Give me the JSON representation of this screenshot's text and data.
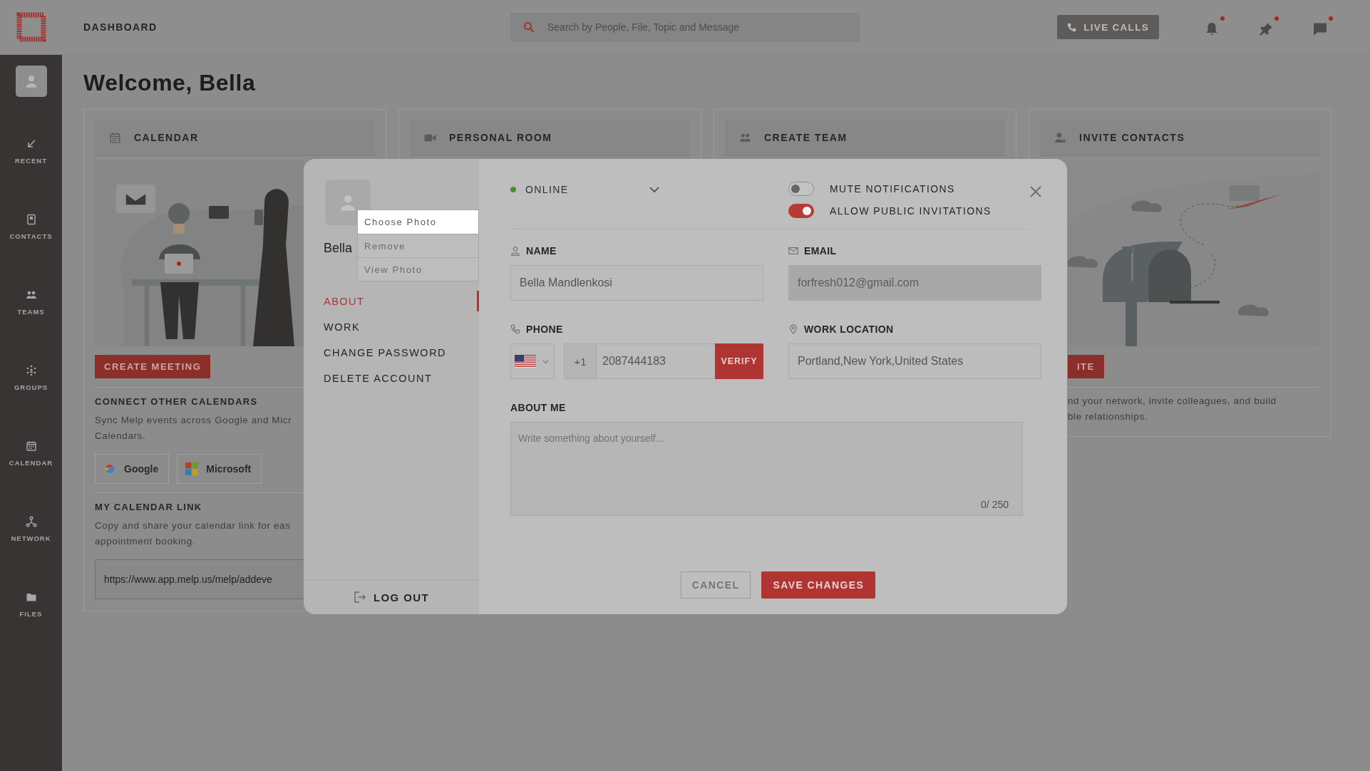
{
  "top_bar": {
    "title": "DASHBOARD",
    "search": {
      "placeholder": "Search by People, File, Topic and Message"
    },
    "live_calls": "LIVE CALLS",
    "icons": [
      {
        "kind": "bell",
        "badge": true
      },
      {
        "kind": "pin",
        "badge": true
      },
      {
        "kind": "chat",
        "badge": true
      }
    ]
  },
  "sidebar": {
    "items": [
      {
        "kind": "recent",
        "label": "RECENT"
      },
      {
        "kind": "contacts",
        "label": "CONTACTS"
      },
      {
        "kind": "teams",
        "label": "TEAMS"
      },
      {
        "kind": "groups",
        "label": "GROUPS"
      },
      {
        "kind": "calendar",
        "label": "CALENDAR"
      },
      {
        "kind": "network",
        "label": "NETWORK"
      },
      {
        "kind": "files",
        "label": "FILES"
      }
    ]
  },
  "welcome": "Welcome, Bella",
  "calendar_card": {
    "title": "CALENDAR",
    "button": "CREATE MEETING",
    "connect_title": "CONNECT OTHER CALENDARS",
    "connect_lines": [
      "Sync Melp events across Google and Micr",
      "Calendars."
    ],
    "providers": [
      {
        "kind": "google",
        "label": "Google"
      },
      {
        "kind": "microsoft",
        "label": "Microsoft"
      }
    ],
    "link_title": "MY CALENDAR LINK",
    "link_lines": [
      "Copy and share your calendar link for eas",
      "appointment booking."
    ],
    "link": "https://www.app.melp.us/melp/addeve"
  },
  "other_cards": [
    {
      "kind": "room",
      "title": "PERSONAL ROOM"
    },
    {
      "kind": "team",
      "title": "CREATE TEAM"
    }
  ],
  "invite_card": {
    "title": "INVITE CONTACTS",
    "button": "ITE",
    "lines": [
      "nd your network, invite colleagues, and build",
      "ble relationships."
    ]
  },
  "profile_modal": {
    "name": "Bella",
    "photo_menu": [
      {
        "label": "Choose Photo",
        "selected": true
      },
      {
        "label": "Remove",
        "selected": false
      },
      {
        "label": "View Photo",
        "selected": false
      }
    ],
    "nav": [
      {
        "label": "ABOUT",
        "selected": true
      },
      {
        "label": "WORK",
        "selected": false
      },
      {
        "label": "CHANGE PASSWORD",
        "selected": false
      },
      {
        "label": "DELETE ACCOUNT",
        "selected": false
      }
    ],
    "logout": "LOG OUT",
    "status": {
      "kind": "online",
      "label": "ONLINE"
    },
    "toggles": [
      {
        "label": "MUTE NOTIFICATIONS",
        "on": false
      },
      {
        "label": "ALLOW PUBLIC INVITATIONS",
        "on": true
      }
    ],
    "fields": [
      {
        "kind": "name",
        "label": "NAME",
        "value": "Bella Mandlenkosi",
        "disabled": false
      },
      {
        "kind": "email",
        "label": "EMAIL",
        "value": "forfresh012@gmail.com",
        "disabled": true
      },
      {
        "kind": "phone",
        "label": "PHONE",
        "country_code": "+1",
        "value": "2087444183",
        "action": "VERIFY",
        "disabled": false
      },
      {
        "kind": "location",
        "label": "WORK LOCATION",
        "value": "Portland,New York,United States",
        "disabled": false
      }
    ],
    "about": {
      "label": "ABOUT ME",
      "placeholder": "Write something about yourself...",
      "counter": "0/ 250"
    },
    "cancel": "CANCEL",
    "save": "SAVE CHANGES"
  }
}
